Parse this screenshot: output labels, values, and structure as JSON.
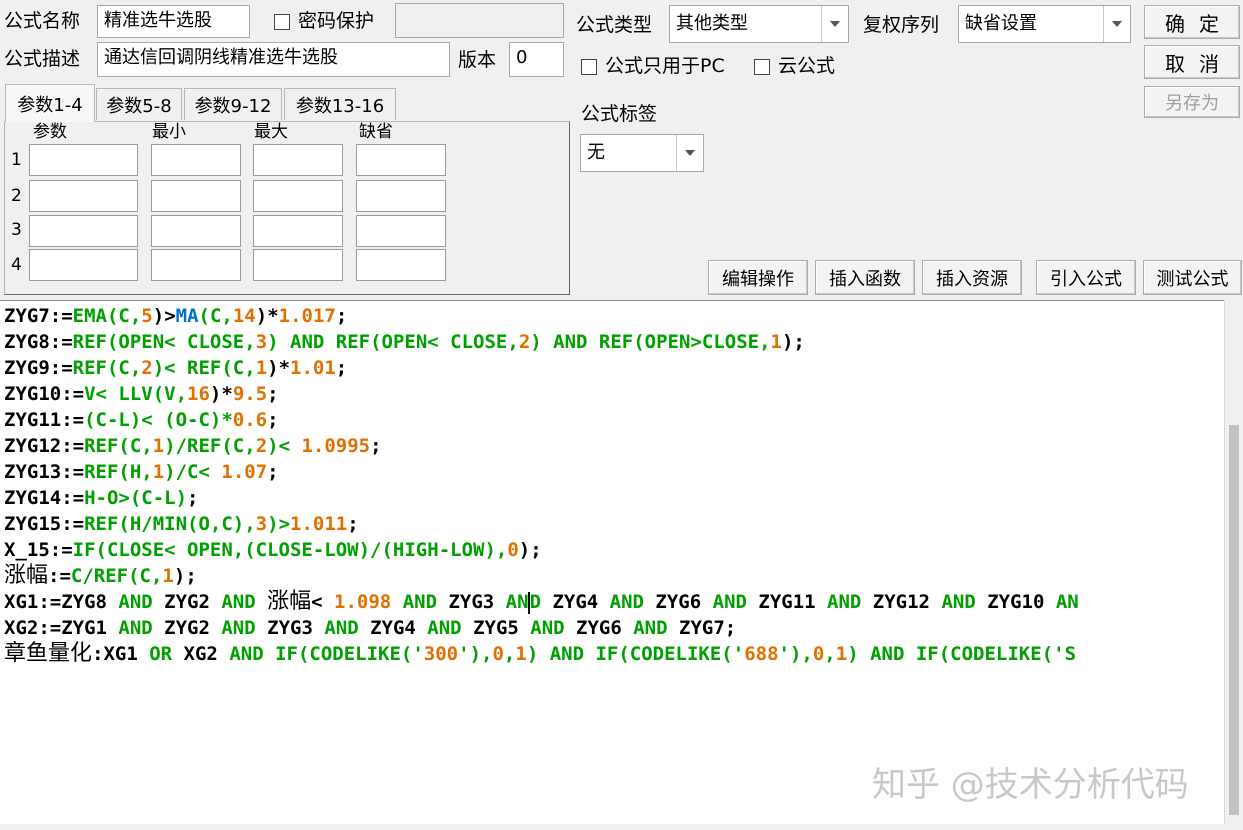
{
  "formula": {
    "name_label": "公式名称",
    "name_value": "精准选牛选股",
    "password_label": "密码保护",
    "password_checked": false,
    "desc_label": "公式描述",
    "desc_value": "通达信回调阴线精准选牛选股",
    "version_label": "版本",
    "version_value": "0",
    "type_label": "公式类型",
    "type_value": "其他类型",
    "rights_label": "复权序列",
    "rights_value": "缺省设置",
    "pc_only_label": "公式只用于PC",
    "pc_only_checked": false,
    "cloud_label": "云公式",
    "cloud_checked": false,
    "tag_label": "公式标签",
    "tag_value": "无"
  },
  "buttons": {
    "ok": "确定",
    "cancel": "取消",
    "save_as": "另存为",
    "edit_ops": "编辑操作",
    "insert_func": "插入函数",
    "insert_res": "插入资源",
    "import": "引入公式",
    "test": "测试公式"
  },
  "params": {
    "tabs": [
      "参数1-4",
      "参数5-8",
      "参数9-12",
      "参数13-16"
    ],
    "active_tab": 0,
    "headers": [
      "参数",
      "最小",
      "最大",
      "缺省"
    ],
    "rows": [
      "1",
      "2",
      "3",
      "4"
    ]
  },
  "code_lines": [
    [
      [
        "ZYG7:=",
        "k"
      ],
      [
        "EMA",
        "f"
      ],
      [
        "(C,",
        "f"
      ],
      [
        "5",
        "n"
      ],
      [
        ")>",
        "k"
      ],
      [
        "MA",
        "b"
      ],
      [
        "(C,",
        "f"
      ],
      [
        "14",
        "n"
      ],
      [
        ")*",
        "k"
      ],
      [
        "1.",
        "n"
      ],
      [
        "017",
        "n"
      ],
      [
        ";",
        "k"
      ]
    ],
    [
      [
        "ZYG8:=",
        "k"
      ],
      [
        "REF(OPEN< CLOSE,",
        "f"
      ],
      [
        "3",
        "n"
      ],
      [
        ") ",
        "f"
      ],
      [
        "AND",
        "f"
      ],
      [
        " REF(OPEN< CLOSE,",
        "f"
      ],
      [
        "2",
        "n"
      ],
      [
        ") ",
        "f"
      ],
      [
        "AND",
        "f"
      ],
      [
        " REF(OPEN>CLOSE,",
        "f"
      ],
      [
        "1",
        "n"
      ],
      [
        ");",
        "k"
      ]
    ],
    [
      [
        "ZYG9:=",
        "k"
      ],
      [
        "REF(C,",
        "f"
      ],
      [
        "2",
        "n"
      ],
      [
        ")< REF(C,",
        "f"
      ],
      [
        "1",
        "n"
      ],
      [
        ")*",
        "k"
      ],
      [
        "1.01",
        "n"
      ],
      [
        ";",
        "k"
      ]
    ],
    [
      [
        "ZYG10:=",
        "k"
      ],
      [
        "V< LLV(V,",
        "f"
      ],
      [
        "16",
        "n"
      ],
      [
        ")*",
        "k"
      ],
      [
        "9.5",
        "n"
      ],
      [
        ";",
        "k"
      ]
    ],
    [
      [
        "ZYG11:=",
        "k"
      ],
      [
        "(C-L)< (O-C)*",
        "f"
      ],
      [
        "0.6",
        "n"
      ],
      [
        ";",
        "k"
      ]
    ],
    [
      [
        "ZYG12:=",
        "k"
      ],
      [
        "REF(C,",
        "f"
      ],
      [
        "1",
        "n"
      ],
      [
        ")/REF(C,",
        "f"
      ],
      [
        "2",
        "n"
      ],
      [
        ")< ",
        "f"
      ],
      [
        "1.0995",
        "n"
      ],
      [
        ";",
        "k"
      ]
    ],
    [
      [
        "ZYG13:=",
        "k"
      ],
      [
        "REF(H,",
        "f"
      ],
      [
        "1",
        "n"
      ],
      [
        ")/C< ",
        "f"
      ],
      [
        "1.07",
        "n"
      ],
      [
        ";",
        "k"
      ]
    ],
    [
      [
        "ZYG14:=",
        "k"
      ],
      [
        "H-O>(C-L)",
        "f"
      ],
      [
        ";",
        "k"
      ]
    ],
    [
      [
        "ZYG15:=",
        "k"
      ],
      [
        "REF(H/MIN(O,C),",
        "f"
      ],
      [
        "3",
        "n"
      ],
      [
        ")>",
        "f"
      ],
      [
        "1.011",
        "n"
      ],
      [
        ";",
        "k"
      ]
    ],
    [
      [
        "X_15:=",
        "k"
      ],
      [
        "IF(CLOSE< OPEN,(CLOSE-LOW)/(HIGH-LOW),",
        "f"
      ],
      [
        "0",
        "n"
      ],
      [
        ");",
        "k"
      ]
    ],
    [
      [
        "涨幅",
        "cjk"
      ],
      [
        ":=",
        "k"
      ],
      [
        "C/REF(C,",
        "f"
      ],
      [
        "1",
        "n"
      ],
      [
        ");",
        "k"
      ]
    ],
    [
      [
        "XG1:=ZYG8 ",
        "k"
      ],
      [
        "AND",
        "f"
      ],
      [
        " ZYG2 ",
        "k"
      ],
      [
        "AND",
        "f"
      ],
      [
        " ",
        "k"
      ],
      [
        "涨幅",
        "cjk"
      ],
      [
        "< ",
        "k"
      ],
      [
        "1.098",
        "n"
      ],
      [
        " ",
        "k"
      ],
      [
        "AND",
        "f"
      ],
      [
        " ZYG3 ",
        "k"
      ],
      [
        "AN",
        "f"
      ],
      [
        "|",
        "caret"
      ],
      [
        "D",
        "f"
      ],
      [
        " ZYG4 ",
        "k"
      ],
      [
        "AND",
        "f"
      ],
      [
        " ZYG6 ",
        "k"
      ],
      [
        "AND",
        "f"
      ],
      [
        " ZYG11 ",
        "k"
      ],
      [
        "AND",
        "f"
      ],
      [
        " ZYG12 ",
        "k"
      ],
      [
        "AND",
        "f"
      ],
      [
        " ZYG10 ",
        "k"
      ],
      [
        "AN",
        "f"
      ]
    ],
    [
      [
        "XG2:=ZYG1 ",
        "k"
      ],
      [
        "AND",
        "f"
      ],
      [
        " ZYG2 ",
        "k"
      ],
      [
        "AND",
        "f"
      ],
      [
        " ZYG3 ",
        "k"
      ],
      [
        "AND",
        "f"
      ],
      [
        " ZYG4 ",
        "k"
      ],
      [
        "AND",
        "f"
      ],
      [
        " ZYG5 ",
        "k"
      ],
      [
        "AND",
        "f"
      ],
      [
        " ZYG6 ",
        "k"
      ],
      [
        "AND",
        "f"
      ],
      [
        " ZYG7;",
        "k"
      ]
    ],
    [
      [
        "章鱼量化",
        "cjk"
      ],
      [
        ":XG1 ",
        "k"
      ],
      [
        "OR",
        "f"
      ],
      [
        " XG2 ",
        "k"
      ],
      [
        "AND",
        "f"
      ],
      [
        " IF(CODELIKE('",
        "f"
      ],
      [
        "300",
        "n"
      ],
      [
        "'),",
        "f"
      ],
      [
        "0",
        "n"
      ],
      [
        ",",
        "f"
      ],
      [
        "1",
        "n"
      ],
      [
        ") ",
        "f"
      ],
      [
        "AND",
        "f"
      ],
      [
        " IF(CODELIKE('",
        "f"
      ],
      [
        "688",
        "n"
      ],
      [
        "'),",
        "f"
      ],
      [
        "0",
        "n"
      ],
      [
        ",",
        "f"
      ],
      [
        "1",
        "n"
      ],
      [
        ") ",
        "f"
      ],
      [
        "AND",
        "f"
      ],
      [
        " IF(CODELIKE('S",
        "f"
      ]
    ]
  ],
  "watermark": "知乎 @技术分析代码",
  "colors": {
    "number": "#e07000",
    "function": "#00a000",
    "builtin_ma": "#0070c8",
    "background": "#f0f0f0"
  }
}
